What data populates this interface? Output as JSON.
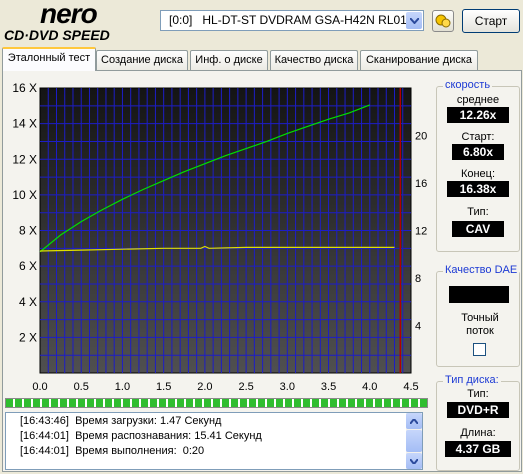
{
  "app": {
    "logo_top": "nero",
    "logo_bottom": "CD·DVD SPEED"
  },
  "drive_select": {
    "value": "[0:0]   HL-DT-ST DVDRAM GSA-H42N RL01"
  },
  "start_button": "Старт",
  "tabs": [
    {
      "label": "Эталонный тест",
      "active": true
    },
    {
      "label": "Создание диска",
      "active": false
    },
    {
      "label": "Инф. о диске",
      "active": false
    },
    {
      "label": "Качество диска",
      "active": false
    },
    {
      "label": "Сканирование диска",
      "active": false
    }
  ],
  "chart_data": {
    "type": "line",
    "xlim": [
      0,
      4.5
    ],
    "x_ticks": [
      "0.0",
      "0.5",
      "1.0",
      "1.5",
      "2.0",
      "2.5",
      "3.0",
      "3.5",
      "4.0",
      "4.5"
    ],
    "y_left_lim": [
      0,
      16
    ],
    "y_left_ticks": [
      "2 X",
      "4 X",
      "6 X",
      "8 X",
      "10 X",
      "12 X",
      "14 X",
      "16 X"
    ],
    "y_right_lim": [
      0,
      24
    ],
    "y_right_ticks": [
      "4",
      "8",
      "12",
      "16",
      "20"
    ],
    "end_marker_x": 4.37,
    "grid": true,
    "series": [
      {
        "color": "#00e000",
        "x": [
          0.0,
          0.25,
          0.5,
          0.75,
          1.0,
          1.25,
          1.5,
          1.75,
          2.0,
          2.25,
          2.5,
          2.75,
          3.0,
          3.25,
          3.5,
          3.75,
          4.0
        ],
        "y": [
          6.8,
          7.75,
          8.5,
          9.15,
          9.75,
          10.3,
          10.8,
          11.3,
          11.75,
          12.2,
          12.6,
          13.0,
          13.45,
          13.85,
          14.25,
          14.6,
          15.05
        ]
      },
      {
        "color": "#e0e000",
        "x": [
          0.0,
          0.5,
          1.0,
          1.5,
          1.95,
          2.0,
          2.05,
          2.5,
          3.0,
          3.5,
          4.0,
          4.3
        ],
        "y": [
          6.85,
          6.9,
          6.95,
          7.0,
          7.0,
          7.1,
          7.0,
          7.05,
          7.05,
          7.05,
          7.05,
          7.05
        ]
      }
    ]
  },
  "speed_panel": {
    "title": "скорость",
    "avg_label": "среднее",
    "avg_value": "12.26x",
    "start_label": "Старт:",
    "start_value": "6.80x",
    "end_label": "Конец:",
    "end_value": "16.38x",
    "type_label": "Тип:",
    "type_value": "CAV"
  },
  "dae_panel": {
    "title": "Качество DAE",
    "accurate_label_1": "Точный",
    "accurate_label_2": "поток"
  },
  "disc_panel": {
    "title": "Тип диска:",
    "type_label": "Тип:",
    "type_value": "DVD+R",
    "length_label": "Длина:",
    "length_value": "4.37 GB"
  },
  "progress": {
    "fraction": 1.0
  },
  "log": [
    {
      "time": "[16:43:46]",
      "text": "Время загрузки: 1.47 Секунд"
    },
    {
      "time": "[16:44:01]",
      "text": "Время распознавания: 15.41 Секунд"
    },
    {
      "time": "[16:44:01]",
      "text": "Время выполнения:  0:20"
    }
  ],
  "colors": {
    "chart_bg_top": "#1a1a1a",
    "chart_bg_bottom": "#4a4a4a",
    "grid": "#1d1dc8",
    "marker": "#b00000",
    "value_box": "#000000"
  }
}
